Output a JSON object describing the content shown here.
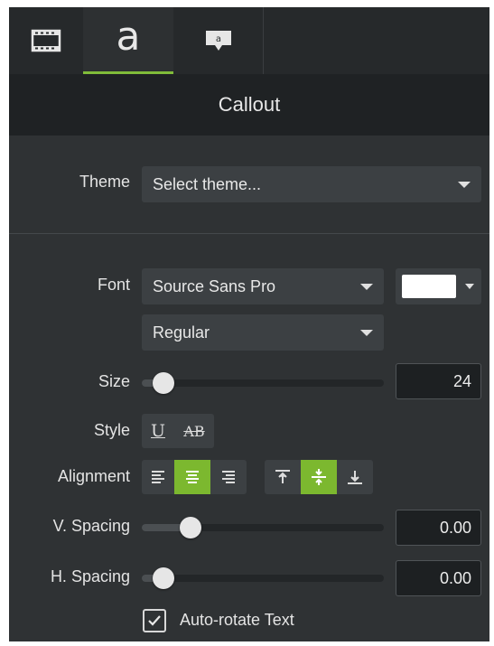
{
  "tabs": [
    {
      "name": "media",
      "icon": "film-strip-icon",
      "active": false
    },
    {
      "name": "text",
      "label": "a",
      "icon": "text-a-icon",
      "active": true
    },
    {
      "name": "callout",
      "label": "a",
      "icon": "callout-bubble-icon",
      "active": false
    }
  ],
  "header": {
    "title": "Callout"
  },
  "theme": {
    "label": "Theme",
    "value": "Select theme..."
  },
  "font": {
    "label": "Font",
    "family": "Source Sans Pro",
    "weight": "Regular",
    "color": "#ffffff"
  },
  "size": {
    "label": "Size",
    "value": "24",
    "slider_fraction": 0.06
  },
  "style": {
    "label": "Style",
    "underline": "U",
    "strikethrough": "AB"
  },
  "alignment": {
    "label": "Alignment",
    "horizontal": [
      {
        "name": "align-left",
        "active": false
      },
      {
        "name": "align-center",
        "active": true
      },
      {
        "name": "align-right",
        "active": false
      }
    ],
    "vertical": [
      {
        "name": "align-top",
        "active": false
      },
      {
        "name": "align-middle",
        "active": true
      },
      {
        "name": "align-bottom",
        "active": false
      }
    ]
  },
  "v_spacing": {
    "label": "V. Spacing",
    "value": "0.00",
    "slider_fraction": 0.17
  },
  "h_spacing": {
    "label": "H. Spacing",
    "value": "0.00",
    "slider_fraction": 0.06
  },
  "auto_rotate": {
    "label": "Auto-rotate Text",
    "checked": true
  },
  "colors": {
    "accent": "#7cb82f",
    "panel": "#2f3234",
    "header": "#1f2224",
    "control": "#3c4043"
  }
}
